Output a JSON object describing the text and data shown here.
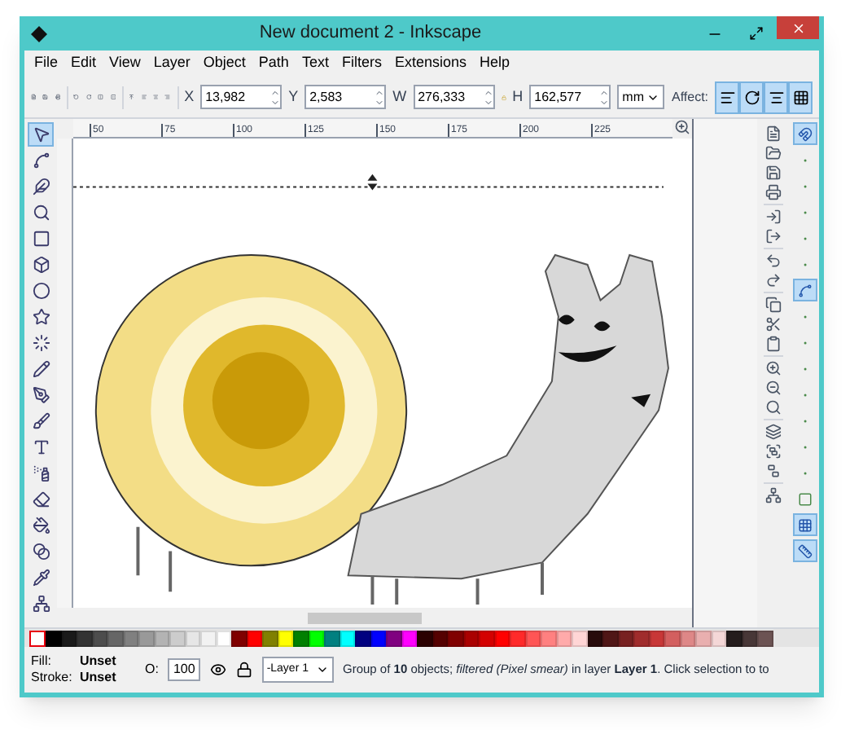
{
  "window": {
    "title": "New document 2 - Inkscape"
  },
  "menu": [
    "File",
    "Edit",
    "View",
    "Layer",
    "Object",
    "Path",
    "Text",
    "Filters",
    "Extensions",
    "Help"
  ],
  "toolbar": {
    "fields": [
      {
        "label": "X",
        "value": "13,982"
      },
      {
        "label": "Y",
        "value": "2,583"
      },
      {
        "label": "W",
        "value": "276,333"
      },
      {
        "label": "H",
        "value": "162,577"
      }
    ],
    "unit": "mm",
    "affect_label": "Affect:",
    "affect": [
      {
        "selected": true
      },
      {
        "selected": true
      },
      {
        "selected": true
      },
      {
        "selected": true
      }
    ]
  },
  "ruler": [
    "50",
    "75",
    "100",
    "125",
    "150",
    "175",
    "200",
    "225"
  ],
  "tools": [
    {
      "selected": true
    },
    {
      "selected": false
    },
    {
      "selected": false
    },
    {
      "selected": false
    },
    {
      "selected": false
    },
    {
      "selected": false
    },
    {
      "selected": false
    },
    {
      "selected": false
    },
    {
      "selected": false
    },
    {
      "selected": false
    },
    {
      "selected": false
    },
    {
      "selected": false
    },
    {
      "selected": false
    },
    {
      "selected": false
    },
    {
      "selected": false
    },
    {
      "selected": false
    },
    {
      "selected": false
    },
    {
      "selected": false
    },
    {
      "selected": false
    }
  ],
  "snap": [
    {
      "on": true
    },
    {
      "on": false
    },
    {
      "on": false
    },
    {
      "on": false
    },
    {
      "on": false
    },
    {
      "on": false
    },
    {
      "on": true
    },
    {
      "on": false
    },
    {
      "on": false
    },
    {
      "on": false
    },
    {
      "on": false
    },
    {
      "on": false
    },
    {
      "on": false
    },
    {
      "on": false
    },
    {
      "on": false
    },
    {
      "on": true
    },
    {
      "on": true
    }
  ],
  "palette": [
    {
      "color": "#000000"
    },
    {
      "color": "#1a1a1a"
    },
    {
      "color": "#333333"
    },
    {
      "color": "#4d4d4d"
    },
    {
      "color": "#666666"
    },
    {
      "color": "#808080"
    },
    {
      "color": "#999999"
    },
    {
      "color": "#b3b3b3"
    },
    {
      "color": "#cccccc"
    },
    {
      "color": "#e6e6e6"
    },
    {
      "color": "#f2f2f2"
    },
    {
      "color": "#ffffff"
    },
    {
      "color": "#800000"
    },
    {
      "color": "#ff0000"
    },
    {
      "color": "#808000"
    },
    {
      "color": "#ffff00"
    },
    {
      "color": "#008000"
    },
    {
      "color": "#00ff00"
    },
    {
      "color": "#008080"
    },
    {
      "color": "#00ffff"
    },
    {
      "color": "#000080"
    },
    {
      "color": "#0000ff"
    },
    {
      "color": "#800080"
    },
    {
      "color": "#ff00ff"
    },
    {
      "color": "#2b0000"
    },
    {
      "color": "#550000"
    },
    {
      "color": "#800000"
    },
    {
      "color": "#aa0000"
    },
    {
      "color": "#d40000"
    },
    {
      "color": "#ff0000"
    },
    {
      "color": "#ff2a2a"
    },
    {
      "color": "#ff5555"
    },
    {
      "color": "#ff8080"
    },
    {
      "color": "#ffaaaa"
    },
    {
      "color": "#ffd5d5"
    },
    {
      "color": "#280b0b"
    },
    {
      "color": "#501616"
    },
    {
      "color": "#782121"
    },
    {
      "color": "#a02c2c"
    },
    {
      "color": "#c83737"
    },
    {
      "color": "#d35f5f"
    },
    {
      "color": "#de8787"
    },
    {
      "color": "#e9afaf"
    },
    {
      "color": "#f4d7d7"
    },
    {
      "color": "#241c1c"
    },
    {
      "color": "#483737"
    },
    {
      "color": "#6c5353"
    }
  ],
  "status": {
    "fill_label": "Fill:",
    "fill_value": "Unset",
    "stroke_label": "Stroke:",
    "stroke_value": "Unset",
    "opacity_label": "O:",
    "opacity": "100",
    "layer": "-Layer 1",
    "message": "Group of **10** objects; *filtered (Pixel smear)* in layer **Layer 1**. Click selection to to"
  }
}
